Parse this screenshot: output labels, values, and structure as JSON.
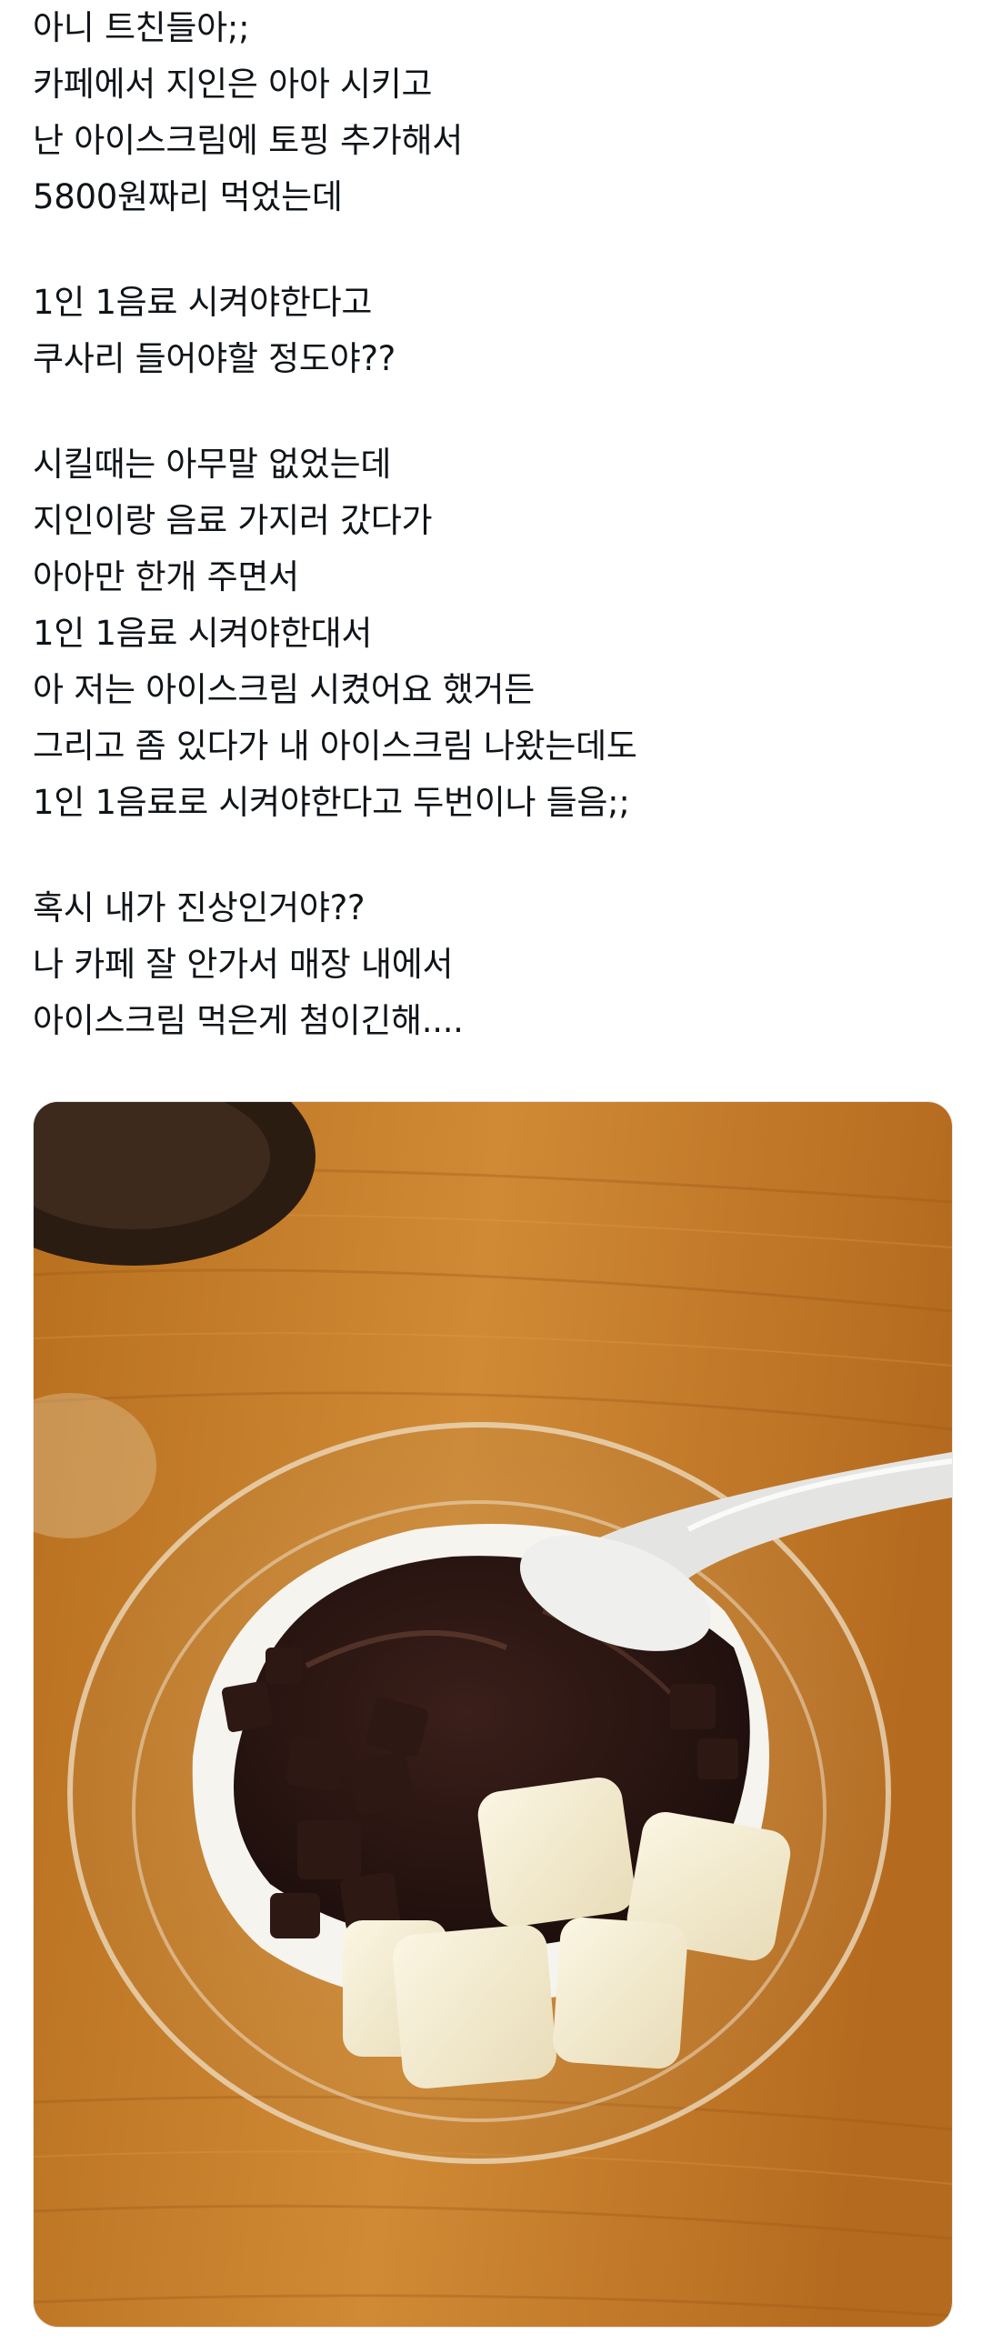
{
  "post": {
    "paragraphs": [
      [
        "아니 트친들아;;",
        "카페에서 지인은 아아 시키고",
        "난 아이스크림에 토핑 추가해서",
        "5800원짜리 먹었는데"
      ],
      [
        "1인 1음료 시켜야한다고",
        "쿠사리 들어야할 정도야??"
      ],
      [
        "시킬때는 아무말 없었는데",
        "지인이랑 음료 가지러 갔다가",
        "아아만 한개 주면서",
        "1인 1음료 시켜야한대서",
        "아 저는 아이스크림 시켰어요 했거든",
        "그리고 좀 있다가 내 아이스크림 나왔는데도",
        "1인 1음료로 시켜야한다고 두번이나 들음;;"
      ],
      [
        "혹시 내가 진상인거야??",
        "나 카페 잘 안가서 매장 내에서",
        "아이스크림 먹은게 첨이긴해...."
      ]
    ]
  },
  "colors": {
    "text": "#0f1419",
    "table_wood": "#c97f2c",
    "chocolate": "#2a1512",
    "ice_cream": "#f6f4ef",
    "mochi": "#f3ead0"
  },
  "media": {
    "icons": [
      "photo-attachment"
    ]
  }
}
